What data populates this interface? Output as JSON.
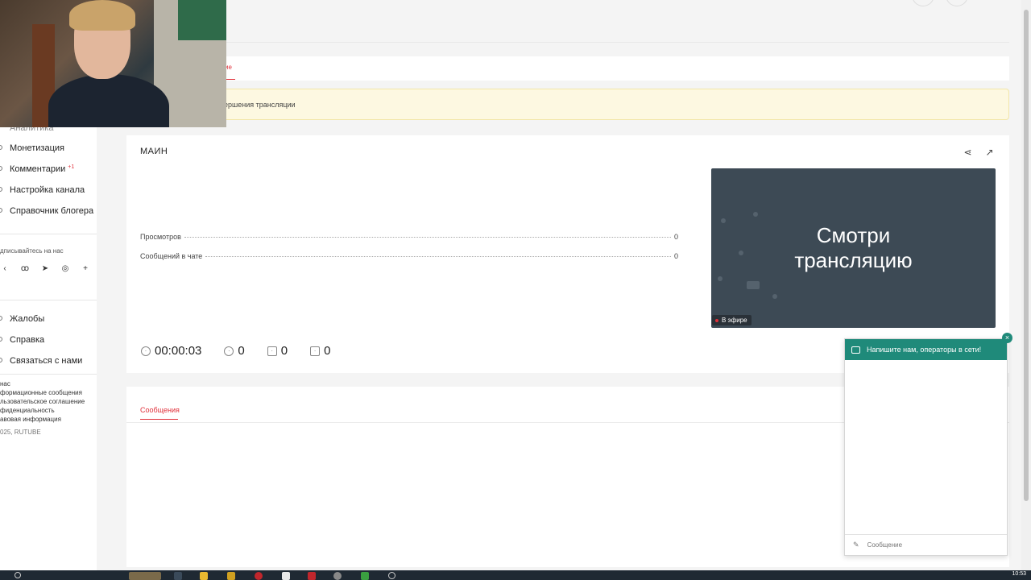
{
  "sidebar": {
    "partial_top_item": "Аналитика",
    "items": [
      {
        "label": "Монетизация",
        "badge": ""
      },
      {
        "label": "Комментарии",
        "badge": "+1"
      },
      {
        "label": "Настройка канала",
        "badge": ""
      },
      {
        "label": "Справочник блогера",
        "badge": ""
      }
    ],
    "subscribe_label": "дписывайтесь на нас",
    "social_icons": [
      "odnoklassniki-icon",
      "telegram-icon",
      "viber-icon",
      "plus-icon"
    ],
    "support_items": [
      "Жалобы",
      "Справка",
      "Связаться с нами"
    ],
    "footer_links": [
      "нас",
      "формационные сообщения",
      "льзовательское соглашение",
      "фиденциальность",
      "авовая информация",
      "025, RUTUBE"
    ]
  },
  "notice_text": "ершения трансляции",
  "stream": {
    "title": "МАИН",
    "stats": [
      {
        "label": "Просмотров",
        "value": "0"
      },
      {
        "label": "Сообщений в чате",
        "value": "0"
      }
    ],
    "duration": "00:00:03",
    "viewers": "0",
    "likes": "0",
    "dislikes": "0",
    "preview_title_line1": "Смотри",
    "preview_title_line2": "трансляцию",
    "live_label": "В эфире"
  },
  "messages_tab": "Сообщения",
  "chat": {
    "header": "Напишите нам, операторы в сети!",
    "input_placeholder": "Сообщение",
    "close_symbol": "×"
  },
  "clock": "10:53"
}
